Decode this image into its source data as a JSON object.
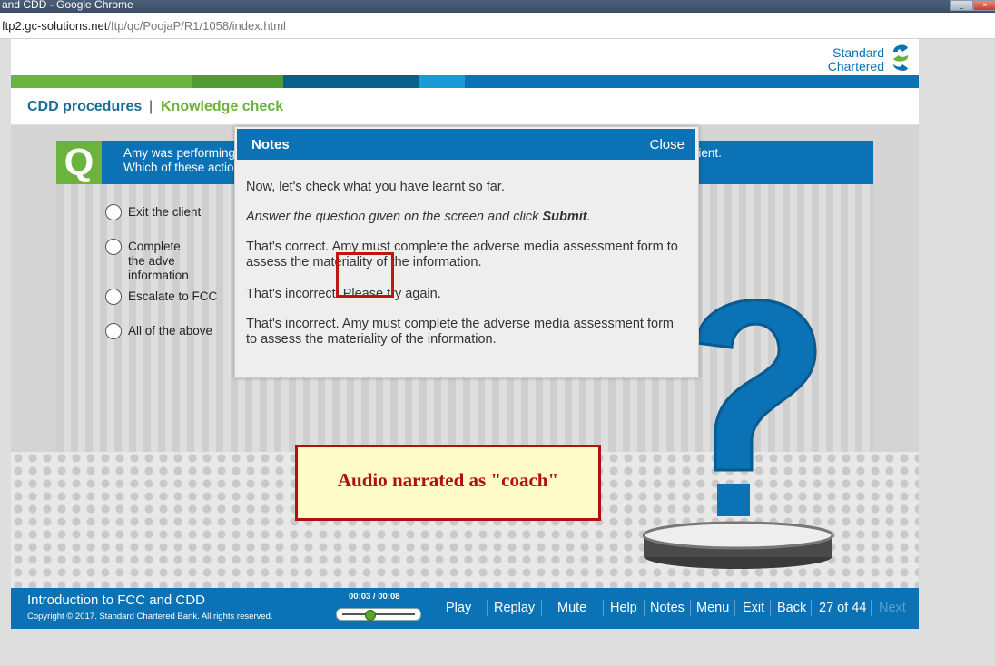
{
  "browser": {
    "window_title": "and CDD - Google Chrome",
    "url_host": "ftp2.gc-solutions.net",
    "url_path": "/ftp/qc/PoojaP/R1/1058/index.html",
    "controls": [
      "_",
      "×"
    ]
  },
  "course": {
    "brand_line1": "Standard",
    "brand_line2": "Chartered",
    "breadcrumb": {
      "section": "CDD procedures",
      "separator": "|",
      "page": "Knowledge check"
    },
    "question": {
      "badge": "Q",
      "text": "Amy was performing an internet public domain search on a client when she found adverse media on the client.\nWhich of these actions would be appropriate for her to take?"
    },
    "options": [
      {
        "label": "Exit the client"
      },
      {
        "label": "Complete the adve\ninformation"
      },
      {
        "label": "Escalate to FCC"
      },
      {
        "label": "All of the above"
      }
    ],
    "notes": {
      "title": "Notes",
      "close": "Close",
      "p1": "Now, let's check what you have learnt so far.",
      "p2_prefix": "Answer the question given on the screen and click ",
      "p2_bold": "Submit",
      "p2_suffix": ".",
      "p3": "That's correct. Amy must complete the adverse media assessment form to assess the materiality of the information.",
      "p4": "That's incorrect. Please try again.",
      "p5": "That's incorrect. Amy must complete the adverse media assessment form to assess the materiality of the information."
    },
    "callout": "Audio narrated as \"coach\"",
    "footer": {
      "title": "Introduction to FCC and CDD",
      "copyright": "Copyright © 2017. Standard Chartered Bank. All rights reserved.",
      "time": "00:03 / 00:08",
      "audio_progress": 0.375,
      "nav": {
        "play": "Play",
        "replay": "Replay",
        "mute": "Mute",
        "help": "Help",
        "notes": "Notes",
        "menu": "Menu",
        "exit": "Exit",
        "back": "Back",
        "page": "27 of 44",
        "next": "Next"
      }
    }
  },
  "colors": {
    "brand_blue": "#0a72b5",
    "brand_green": "#6ab33d",
    "callout_red": "#b01010",
    "callout_bg": "#fffbc9"
  }
}
